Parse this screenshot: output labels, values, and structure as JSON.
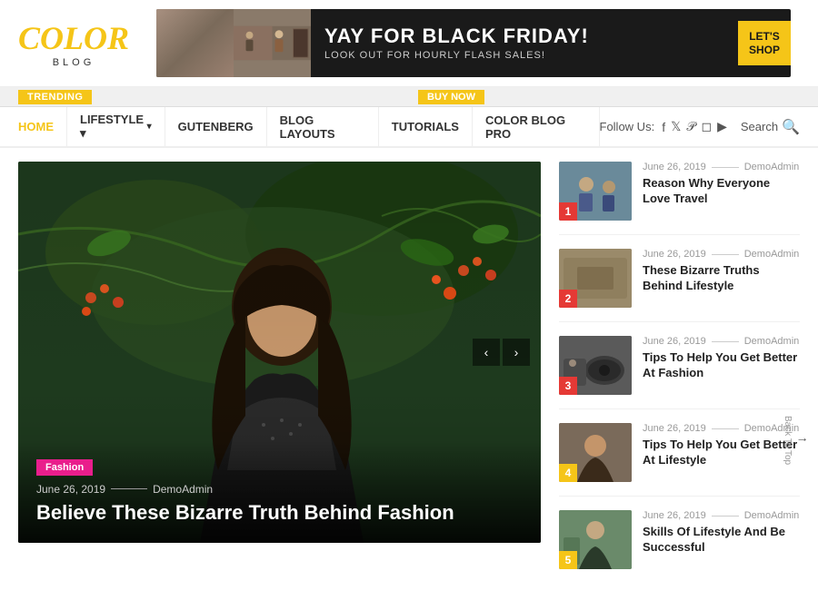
{
  "logo": {
    "title": "COLOR",
    "subtitle": "BLOG"
  },
  "ad": {
    "title": "YAY FOR BLACK FRIDAY!",
    "subtitle": "LOOK OUT FOR HOURLY FLASH SALES!",
    "button_label": "LET'S\nSHOP"
  },
  "trending_label": "TRENDING",
  "buy_now_label": "BUY NOW",
  "nav": {
    "items": [
      {
        "label": "HOME",
        "has_dropdown": false
      },
      {
        "label": "LIFESTYLE",
        "has_dropdown": true
      },
      {
        "label": "GUTENBERG",
        "has_dropdown": false
      },
      {
        "label": "BLOG LAYOUTS",
        "has_dropdown": false
      },
      {
        "label": "TUTORIALS",
        "has_dropdown": false
      },
      {
        "label": "COLOR BLOG PRO",
        "has_dropdown": false
      }
    ],
    "follow_label": "Follow Us:",
    "search_label": "Search"
  },
  "hero": {
    "category": "Fashion",
    "date": "June 26, 2019",
    "author": "DemoAdmin",
    "title": "Believe These Bizarre Truth Behind Fashion",
    "prev_label": "‹",
    "next_label": "›"
  },
  "sidebar": {
    "items": [
      {
        "num": "1",
        "date": "June 26, 2019",
        "author": "DemoAdmin",
        "title": "Reason Why Everyone Love Travel",
        "thumb_class": "thumb-1",
        "num_class": "num-1"
      },
      {
        "num": "2",
        "date": "June 26, 2019",
        "author": "DemoAdmin",
        "title": "These Bizarre Truths Behind Lifestyle",
        "thumb_class": "thumb-2",
        "num_class": "num-2"
      },
      {
        "num": "3",
        "date": "June 26, 2019",
        "author": "DemoAdmin",
        "title": "Tips To Help You Get Better At Fashion",
        "thumb_class": "thumb-3",
        "num_class": "num-3"
      },
      {
        "num": "4",
        "date": "June 26, 2019",
        "author": "DemoAdmin",
        "title": "Tips To Help You Get Better At Lifestyle",
        "thumb_class": "thumb-4",
        "num_class": "num-4"
      },
      {
        "num": "5",
        "date": "June 26, 2019",
        "author": "DemoAdmin",
        "title": "Skills Of Lifestyle And Be Successful",
        "thumb_class": "thumb-5",
        "num_class": "num-5"
      }
    ]
  },
  "back_to_top_label": "Back To Top"
}
